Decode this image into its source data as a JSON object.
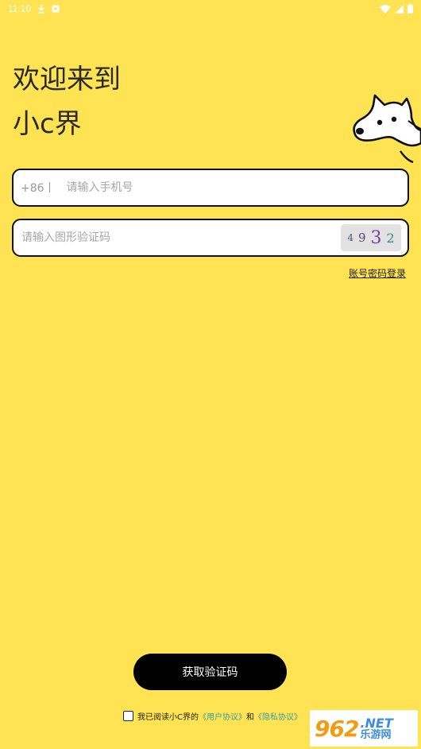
{
  "status_bar": {
    "time": "11:10"
  },
  "welcome": {
    "line1": "欢迎来到",
    "line2": "小c界"
  },
  "phone": {
    "prefix": "+86丨",
    "placeholder": "请输入手机号"
  },
  "captcha": {
    "placeholder": "请输入图形验证码",
    "code": [
      "4",
      "9",
      "3",
      "2"
    ]
  },
  "account_login_link": "账号密码登录",
  "get_code_button": "获取验证码",
  "agreement": {
    "prefix": "我已阅读小C界的",
    "user_agreement": "《用户协议》",
    "and": "和",
    "privacy_agreement": "《隐私协议》"
  },
  "watermark": {
    "logo_num": "962",
    "logo_net": ".NET",
    "logo_cn": "乐游网"
  },
  "colors": {
    "background": "#FFE353",
    "button": "#000000",
    "link": "#3aa0a8"
  }
}
